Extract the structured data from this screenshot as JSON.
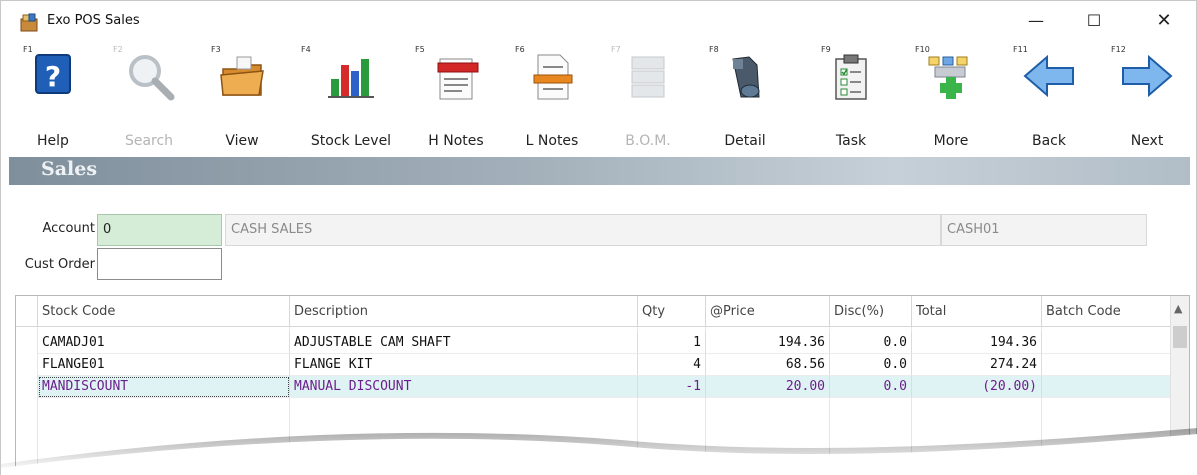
{
  "window": {
    "title": "Exo POS Sales",
    "minimize": "—",
    "maximize": "☐",
    "close": "✕"
  },
  "toolbar": [
    {
      "key": "F1",
      "label": "Help",
      "icon": "help-icon",
      "enabled": true
    },
    {
      "key": "F2",
      "label": "Search",
      "icon": "search-icon",
      "enabled": false
    },
    {
      "key": "F3",
      "label": "View",
      "icon": "folder-icon",
      "enabled": true
    },
    {
      "key": "F4",
      "label": "Stock Level",
      "icon": "bar-chart-icon",
      "enabled": true
    },
    {
      "key": "F5",
      "label": "H Notes",
      "icon": "header-notes-icon",
      "enabled": true
    },
    {
      "key": "F6",
      "label": "L Notes",
      "icon": "line-notes-icon",
      "enabled": true
    },
    {
      "key": "F7",
      "label": "B.O.M.",
      "icon": "bom-icon",
      "enabled": false
    },
    {
      "key": "F8",
      "label": "Detail",
      "icon": "binoculars-icon",
      "enabled": true
    },
    {
      "key": "F9",
      "label": "Task",
      "icon": "clipboard-icon",
      "enabled": true
    },
    {
      "key": "F10",
      "label": "More",
      "icon": "more-icon",
      "enabled": true
    },
    {
      "key": "F11",
      "label": "Back",
      "icon": "back-arrow-icon",
      "enabled": true
    },
    {
      "key": "F12",
      "label": "Next",
      "icon": "next-arrow-icon",
      "enabled": true
    }
  ],
  "banner": {
    "title": "Sales"
  },
  "header": {
    "account_label": "Account",
    "account_value": "0",
    "account_name": "CASH SALES",
    "account_code": "CASH01",
    "cust_order_label": "Cust Order",
    "cust_order_value": ""
  },
  "grid": {
    "columns": [
      "Stock Code",
      "Description",
      "Qty",
      "@Price",
      "Disc(%)",
      "Total",
      "Batch Code"
    ],
    "rows": [
      [
        "CAMADJ01",
        "ADJUSTABLE CAM SHAFT",
        "1",
        "194.36",
        "0.0",
        "194.36",
        ""
      ],
      [
        "FLANGE01",
        "FLANGE KIT",
        "4",
        "68.56",
        "0.0",
        "274.24",
        ""
      ],
      [
        "MANDISCOUNT",
        "MANUAL DISCOUNT",
        "-1",
        "20.00",
        "0.0",
        "(20.00)",
        ""
      ]
    ],
    "selected_row": 2
  },
  "colors": {
    "banner": "#8f9daa",
    "account_field": "#d5ecd7",
    "selected_row": "#dff3f4",
    "selected_text": "#6b1f8a"
  }
}
